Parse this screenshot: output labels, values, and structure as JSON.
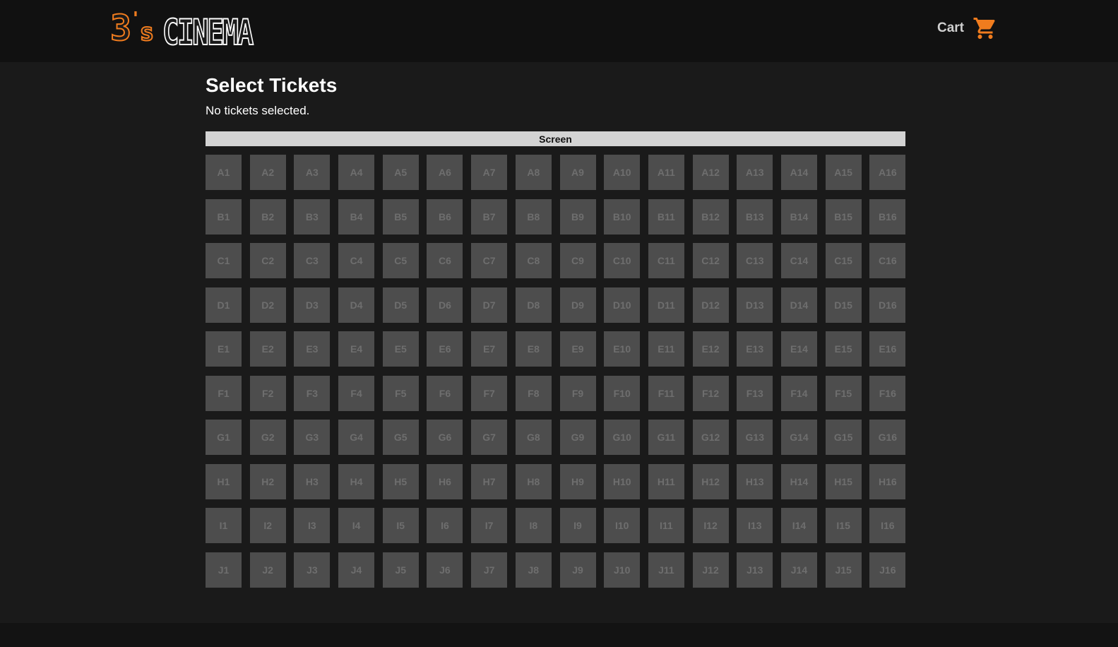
{
  "header": {
    "logo_number": "3",
    "logo_apostrophe": "'",
    "logo_s": "s",
    "logo_word": "CINEMA",
    "cart_label": "Cart",
    "cart_icon": "shopping-cart-icon",
    "accent_color": "#f07c1e"
  },
  "main": {
    "title": "Select Tickets",
    "status": "No tickets selected.",
    "screen_label": "Screen"
  },
  "seating": {
    "rows": [
      "A",
      "B",
      "C",
      "D",
      "E",
      "F",
      "G",
      "H",
      "I",
      "J"
    ],
    "seats_per_row": 16,
    "seat_color": "#4d4d4d",
    "seat_text_color": "#6e6e6e"
  },
  "colors": {
    "background": "#1a1a1a",
    "header_background": "#111111",
    "screen_bar": "#d3d3d3"
  }
}
